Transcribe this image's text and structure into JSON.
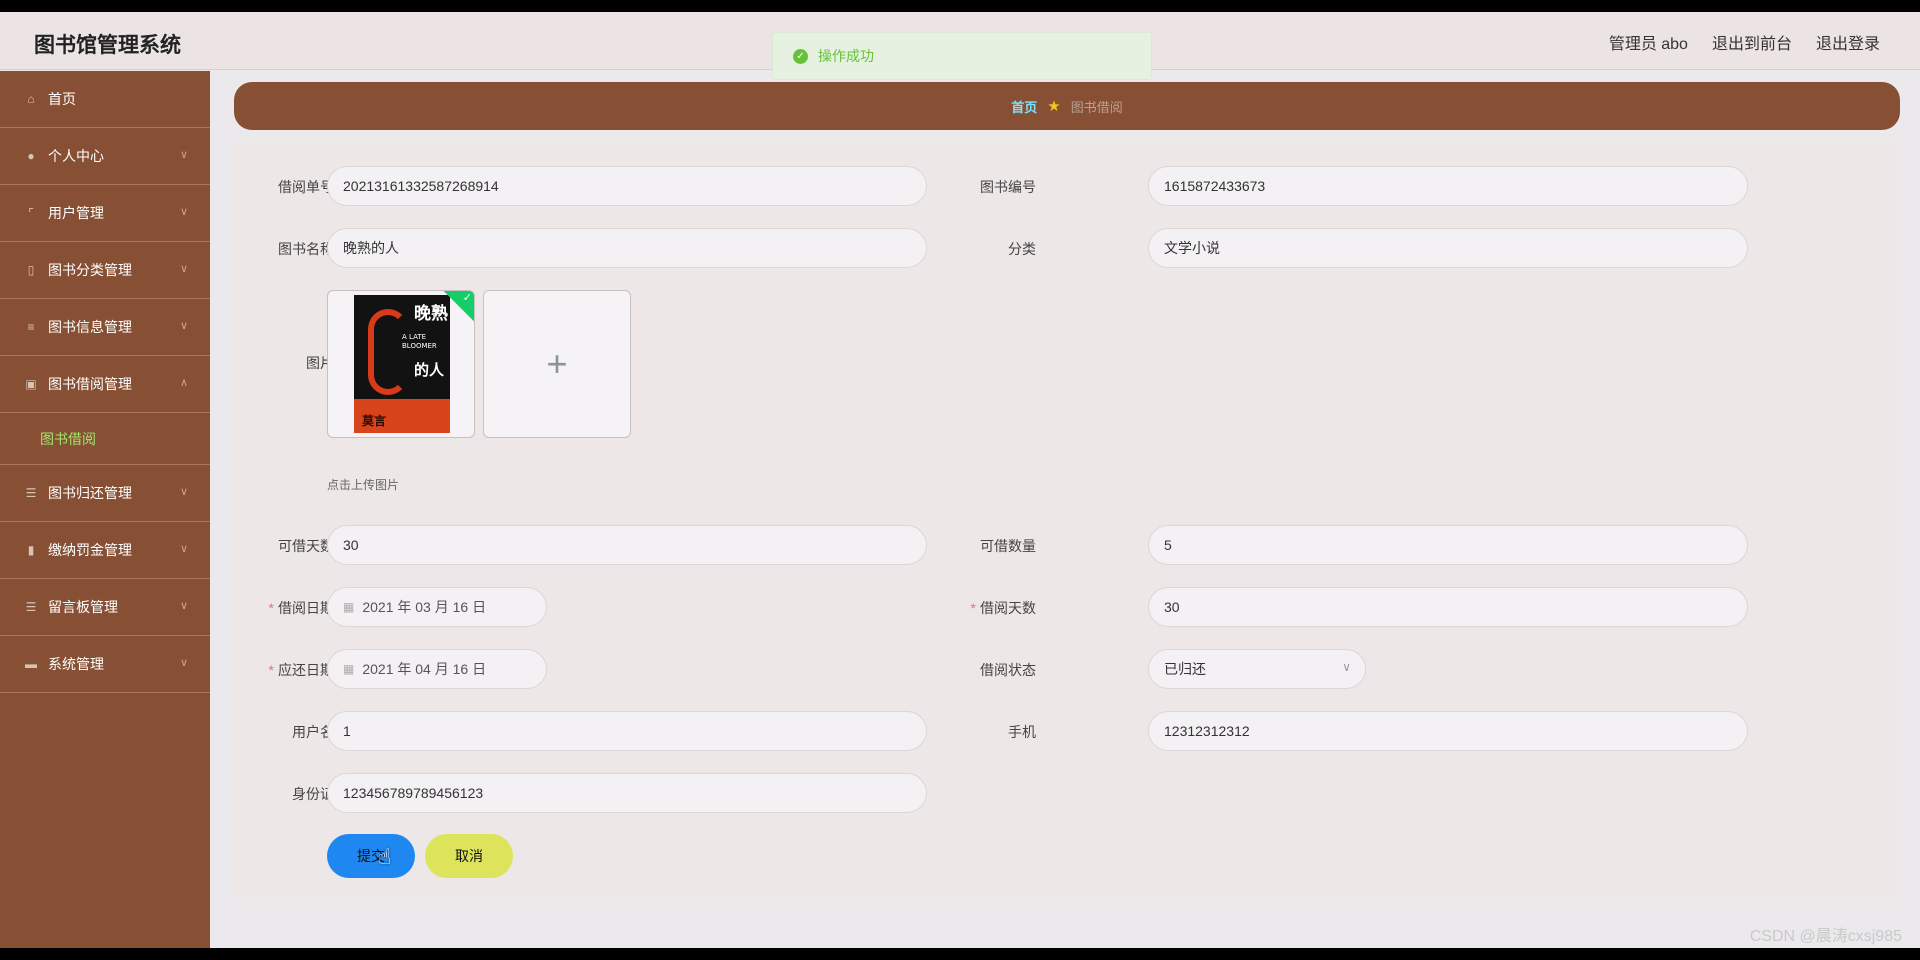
{
  "header": {
    "title": "图书馆管理系统",
    "user": "管理员 abo",
    "to_front": "退出到前台",
    "logout": "退出登录"
  },
  "toast": {
    "message": "操作成功"
  },
  "sidebar": {
    "items": [
      {
        "label": "首页",
        "icon": "home-icon"
      },
      {
        "label": "个人中心",
        "icon": "user-icon"
      },
      {
        "label": "用户管理",
        "icon": "frame-icon"
      },
      {
        "label": "图书分类管理",
        "icon": "mobile-icon"
      },
      {
        "label": "图书信息管理",
        "icon": "sliders-icon"
      },
      {
        "label": "图书借阅管理",
        "icon": "chart-icon"
      },
      {
        "label": "图书借阅",
        "icon": ""
      },
      {
        "label": "图书归还管理",
        "icon": "list-icon"
      },
      {
        "label": "缴纳罚金管理",
        "icon": "bar-chart-icon"
      },
      {
        "label": "留言板管理",
        "icon": "list-icon"
      },
      {
        "label": "系统管理",
        "icon": "ticket-icon"
      }
    ]
  },
  "breadcrumb": {
    "home": "首页",
    "current": "图书借阅"
  },
  "form": {
    "borrow_no_label": "借阅单号",
    "borrow_no": "20213161332587268914",
    "book_no_label": "图书编号",
    "book_no": "1615872433673",
    "book_name_label": "图书名称",
    "book_name": "晚熟的人",
    "category_label": "分类",
    "category": "文学小说",
    "picture_label": "图片",
    "upload_hint": "点击上传图片",
    "cover": {
      "title_top": "晚熟",
      "title_bottom": "的人",
      "en": "A LATE BLOOMER",
      "author": "莫言"
    },
    "borrowable_days_label": "可借天数",
    "borrowable_days": "30",
    "borrowable_qty_label": "可借数量",
    "borrowable_qty": "5",
    "borrow_date_label": "借阅日期",
    "borrow_date": "2021 年 03 月 16 日",
    "borrow_days_label": "借阅天数",
    "borrow_days": "30",
    "due_date_label": "应还日期",
    "due_date": "2021 年 04 月 16 日",
    "status_label": "借阅状态",
    "status": "已归还",
    "username_label": "用户名",
    "username": "1",
    "phone_label": "手机",
    "phone": "12312312312",
    "id_card_label": "身份证",
    "id_card": "123456789789456123",
    "submit": "提交",
    "cancel": "取消"
  },
  "watermark": "CSDN @晨涛cxsj985"
}
